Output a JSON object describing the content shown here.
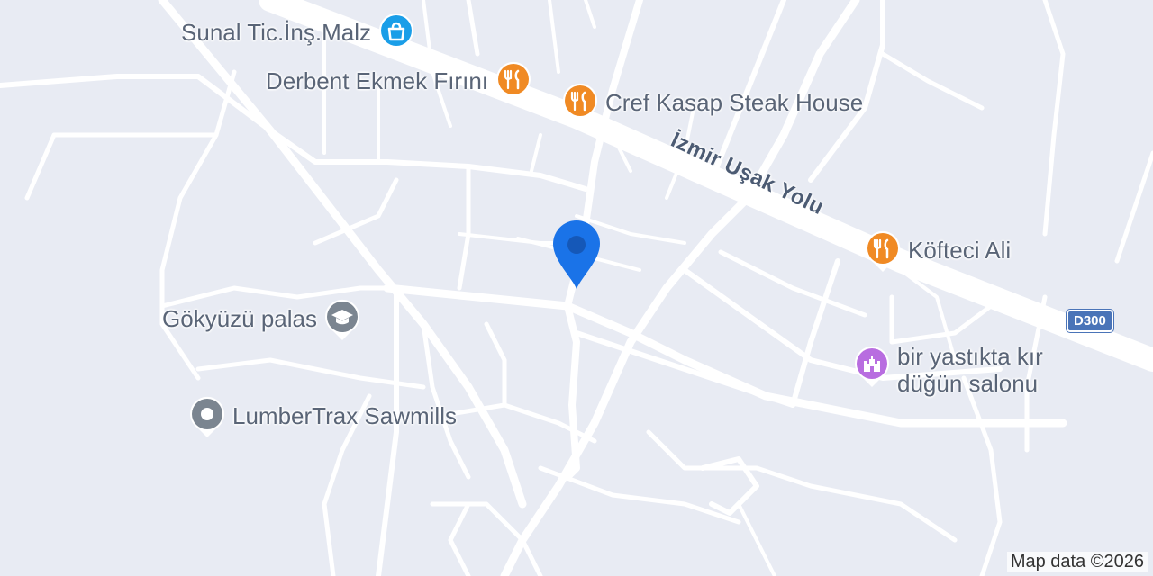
{
  "map": {
    "attribution": "Map data ©2026",
    "road_label": "İzmir Uşak Yolu",
    "route_shield": "D300",
    "colors": {
      "background": "#e8ebf3",
      "road": "#ffffff",
      "restaurant": "#f08a24",
      "shopping": "#1a9ee8",
      "education": "#7b8590",
      "generic": "#7b8590",
      "event_venue": "#b86de0",
      "location_marker": "#1a73e8"
    }
  },
  "pois": [
    {
      "name": "Sunal Tic.İnş.Malz",
      "icon": "shopping-bag-icon",
      "category": "shopping"
    },
    {
      "name": "Derbent Ekmek Fırını",
      "icon": "fork-knife-icon",
      "category": "restaurant"
    },
    {
      "name": "Cref Kasap Steak House",
      "icon": "fork-knife-icon",
      "category": "restaurant"
    },
    {
      "name": "Köfteci Ali",
      "icon": "fork-knife-icon",
      "category": "restaurant"
    },
    {
      "name": "Gökyüzü palas",
      "icon": "graduation-cap-icon",
      "category": "education"
    },
    {
      "name": "LumberTrax Sawmills",
      "icon": "circle-pin-icon",
      "category": "generic"
    },
    {
      "name_line1": "bir yastıkta kır",
      "name_line2": "düğün salonu",
      "icon": "castle-icon",
      "category": "event_venue"
    }
  ]
}
